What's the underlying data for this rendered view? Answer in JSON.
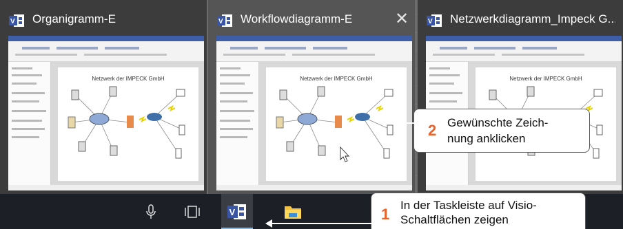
{
  "thumbnails": [
    {
      "title": "Organigramm-E",
      "diagram_title": "Netzwerk der IMPECK GmbH"
    },
    {
      "title": "Workflowdiagramm-E",
      "diagram_title": "Netzwerk der IMPECK GmbH",
      "close_symbol": "✕"
    },
    {
      "title": "Netzwerkdiagramm_Impeck G...",
      "diagram_title": "Netzwerk der IMPECK GmbH"
    }
  ],
  "taskbar": {
    "icons": [
      "microphone-icon",
      "task-view-icon",
      "visio-icon",
      "file-explorer-icon"
    ],
    "accent": "#76b9ed"
  },
  "callouts": {
    "step2": {
      "number": "2",
      "line1": "Gewünschte Zeich-",
      "line2": "nung anklicken"
    },
    "step1": {
      "number": "1",
      "line1": "In der Taskleiste auf Visio-",
      "line2": "Schaltflächen zeigen"
    }
  },
  "colors": {
    "callout_number": "#e8622a",
    "visio_blue": "#3955a3"
  }
}
